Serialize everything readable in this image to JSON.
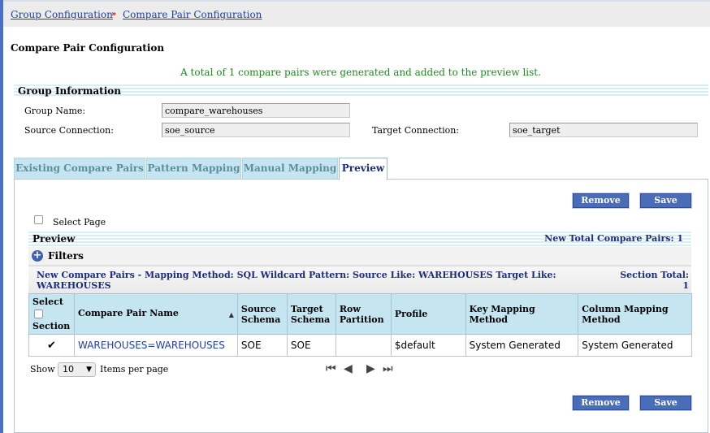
{
  "breadcrumb": {
    "items": [
      "Group Configuration",
      "Compare Pair Configuration"
    ],
    "separator": "››"
  },
  "page": {
    "title": "Compare Pair Configuration",
    "message": "A total of 1 compare pairs were generated and added to the preview list."
  },
  "group_info": {
    "header": "Group Information",
    "group_name_label": "Group Name:",
    "group_name_value": "compare_warehouses",
    "source_label": "Source Connection:",
    "source_value": "soe_source",
    "target_label": "Target Connection:",
    "target_value": "soe_target"
  },
  "tabs": [
    "Existing Compare Pairs",
    "Pattern Mapping",
    "Manual Mapping",
    "Preview"
  ],
  "active_tab": "Preview",
  "actions": {
    "remove": "Remove",
    "save": "Save"
  },
  "select_page_label": "Select Page",
  "preview": {
    "title": "Preview",
    "total_label": "New Total Compare Pairs: 1"
  },
  "filters_label": "Filters",
  "section": {
    "title": "New Compare Pairs - Mapping Method: SQL Wildcard Pattern: Source Like: WAREHOUSES Target Like: WAREHOUSES",
    "total_label": "Section Total:",
    "total_value": "1"
  },
  "table": {
    "select_label": "Select",
    "section_label": "Section",
    "columns": [
      "Compare Pair Name",
      "Source Schema",
      "Target Schema",
      "Row Partition",
      "Profile",
      "Key Mapping Method",
      "Column Mapping Method"
    ],
    "rows": [
      {
        "checked": true,
        "name": "WAREHOUSES=WAREHOUSES",
        "source_schema": "SOE",
        "target_schema": "SOE",
        "row_partition": "",
        "profile": "$default",
        "key_mapping": "System Generated",
        "column_mapping": "System Generated"
      }
    ]
  },
  "pager": {
    "show_label": "Show",
    "page_size": "10",
    "items_per_page_label": "Items per page"
  },
  "colors": {
    "accent": "#4a6db9",
    "header_bg": "#c5e6f1",
    "link": "#1f3fa3",
    "message": "#1e8a1e"
  }
}
